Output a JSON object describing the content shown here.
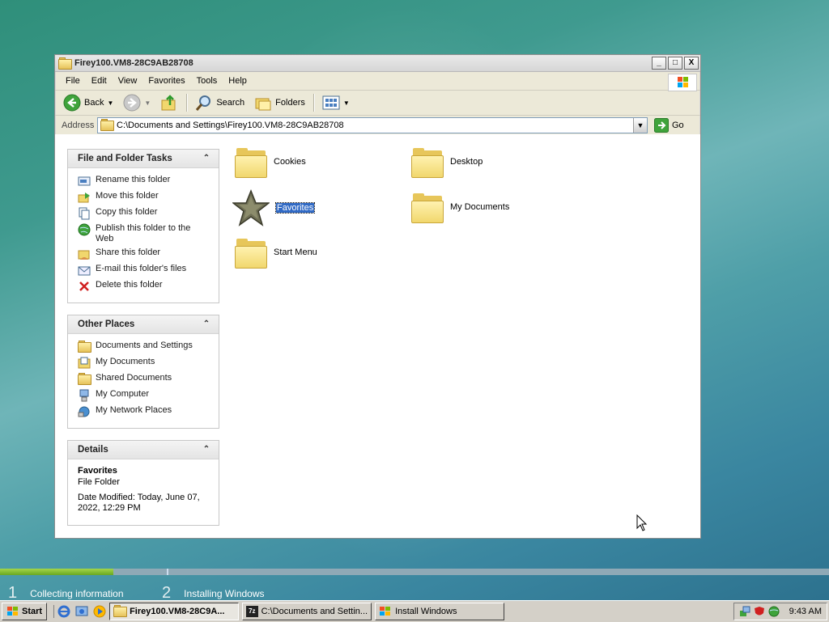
{
  "window": {
    "title": "Firey100.VM8-28C9AB28708",
    "minimize": "_",
    "maximize": "□",
    "close": "X"
  },
  "menu": [
    "File",
    "Edit",
    "View",
    "Favorites",
    "Tools",
    "Help"
  ],
  "toolbar": {
    "back": "Back",
    "search": "Search",
    "folders": "Folders"
  },
  "address": {
    "label": "Address",
    "value": "C:\\Documents and Settings\\Firey100.VM8-28C9AB28708",
    "go": "Go"
  },
  "panes": {
    "tasks": {
      "title": "File and Folder Tasks",
      "items": [
        "Rename this folder",
        "Move this folder",
        "Copy this folder",
        "Publish this folder to the Web",
        "Share this folder",
        "E-mail this folder's files",
        "Delete this folder"
      ]
    },
    "other": {
      "title": "Other Places",
      "items": [
        "Documents and Settings",
        "My Documents",
        "Shared Documents",
        "My Computer",
        "My Network Places"
      ]
    },
    "details": {
      "title": "Details",
      "name": "Favorites",
      "type": "File Folder",
      "modified": "Date Modified: Today, June 07, 2022, 12:29 PM"
    }
  },
  "files": [
    "Cookies",
    "Desktop",
    "Favorites",
    "My Documents",
    "Start Menu"
  ],
  "setup": {
    "step1_num": "1",
    "step1": "Collecting information",
    "step2_num": "2",
    "step2": "Installing Windows",
    "progress": 0.137
  },
  "taskbar": {
    "start": "Start",
    "buttons": [
      "Firey100.VM8-28C9A...",
      "C:\\Documents and Settin...",
      "Install Windows"
    ],
    "clock": "9:43 AM"
  },
  "colors": {
    "selection": "#316ac5",
    "folder": "#e7c65a",
    "progress": "#6aa721"
  }
}
